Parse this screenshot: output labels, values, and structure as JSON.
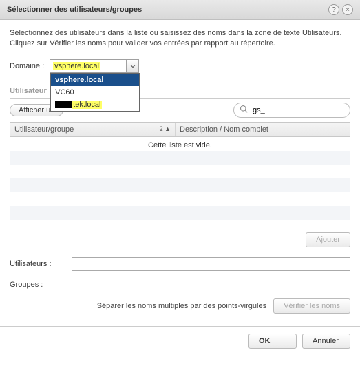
{
  "dialog": {
    "title": "Sélectionner des utilisateurs/groupes",
    "help_tip": "?",
    "close_tip": "×"
  },
  "instructions": "Sélectionnez des utilisateurs dans la liste ou saisissez des noms dans la zone de texte Utilisateurs. Cliquez sur Vérifier les noms pour valider vos entrées par rapport au répertoire.",
  "domain": {
    "label": "Domaine :",
    "value": "vsphere.local",
    "options": [
      {
        "label": "vsphere.local",
        "selected": true,
        "redacted": false
      },
      {
        "label": "VC60",
        "selected": false,
        "redacted": false
      },
      {
        "label_suffix": "tek.local",
        "selected": false,
        "redacted": true
      }
    ]
  },
  "users_section": {
    "heading": "Utilisateur",
    "show_first_btn": "Afficher uti",
    "search_value": "gs_"
  },
  "grid": {
    "col1": "Utilisateur/groupe",
    "col1_sort": "2 ▲",
    "col2": "Description / Nom complet",
    "empty_text": "Cette liste est vide."
  },
  "buttons": {
    "add": "Ajouter",
    "verify": "Vérifier les noms",
    "ok": "OK",
    "cancel": "Annuler"
  },
  "fields": {
    "users_label": "Utilisateurs :",
    "groups_label": "Groupes :",
    "users_value": "",
    "groups_value": "",
    "separator_hint": "Séparer les noms multiples par des points-virgules"
  }
}
